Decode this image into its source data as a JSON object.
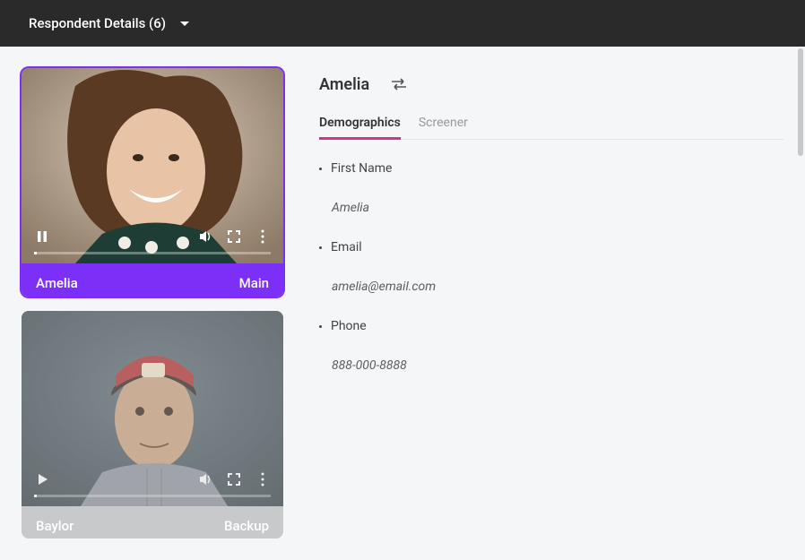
{
  "header": {
    "title": "Respondent Details (6)"
  },
  "respondents": [
    {
      "name": "Amelia",
      "role": "Main",
      "selected": true,
      "playing": true
    },
    {
      "name": "Baylor",
      "role": "Backup",
      "selected": false,
      "playing": false
    }
  ],
  "detail": {
    "name": "Amelia",
    "tabs": [
      {
        "label": "Demographics",
        "active": true
      },
      {
        "label": "Screener",
        "active": false
      }
    ],
    "fields": [
      {
        "label": "First Name",
        "value": "Amelia"
      },
      {
        "label": "Email",
        "value": "amelia@email.com"
      },
      {
        "label": "Phone",
        "value": "888-000-8888"
      }
    ]
  }
}
